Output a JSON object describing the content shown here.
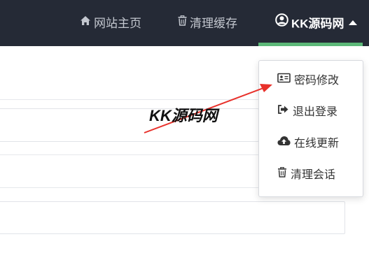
{
  "nav": {
    "home_label": "网站主页",
    "clear_cache_label": "清理缓存",
    "user_label": "KK源码网",
    "home_icon": "home-icon",
    "clear_icon": "trash-icon",
    "user_icon": "user-circle-icon",
    "caret_icon": "caret-up-icon",
    "active_color": "#5cb878",
    "bar_color": "#252a36"
  },
  "dropdown": {
    "items": [
      {
        "label": "密码修改",
        "icon": "id-card-icon"
      },
      {
        "label": "退出登录",
        "icon": "sign-out-icon"
      },
      {
        "label": "在线更新",
        "icon": "cloud-upload-icon"
      },
      {
        "label": "清理会话",
        "icon": "trash-icon"
      }
    ]
  },
  "watermark": {
    "text": "KK源码网",
    "arrow_color": "#e8302a"
  }
}
